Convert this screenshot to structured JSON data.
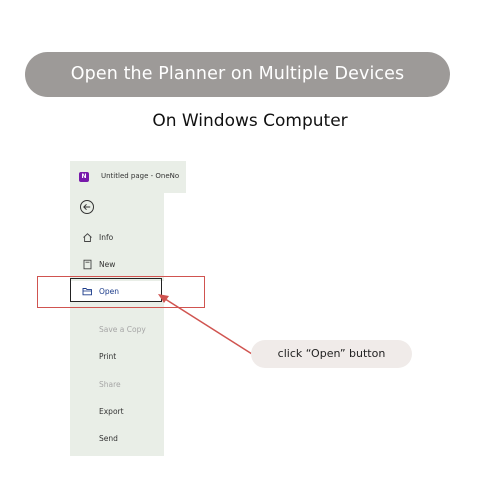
{
  "banner": {
    "text": "Open the Planner on Multiple Devices"
  },
  "subtitle": {
    "text": "On Windows Computer"
  },
  "app": {
    "window_title": "Untitled page - OneNo",
    "app_icon": "onenote-icon",
    "back_icon": "back-arrow-icon",
    "menu": [
      {
        "label": "Info",
        "icon": "home-icon",
        "state": "normal"
      },
      {
        "label": "New",
        "icon": "new-page-icon",
        "state": "normal"
      },
      {
        "label": "Open",
        "icon": "folder-open-icon",
        "state": "highlighted"
      },
      {
        "label": "Save a Copy",
        "icon": "",
        "state": "disabled"
      },
      {
        "label": "Print",
        "icon": "",
        "state": "normal"
      },
      {
        "label": "Share",
        "icon": "",
        "state": "disabled"
      },
      {
        "label": "Export",
        "icon": "",
        "state": "normal"
      },
      {
        "label": "Send",
        "icon": "",
        "state": "normal"
      }
    ]
  },
  "callout": {
    "text": "click “Open” button"
  },
  "colors": {
    "banner_bg": "#9d9a98",
    "highlight_red": "#d05450",
    "callout_bg": "#f0ebe9",
    "sidebar_bg": "#e9eee7",
    "onenote_purple": "#7719aa"
  }
}
